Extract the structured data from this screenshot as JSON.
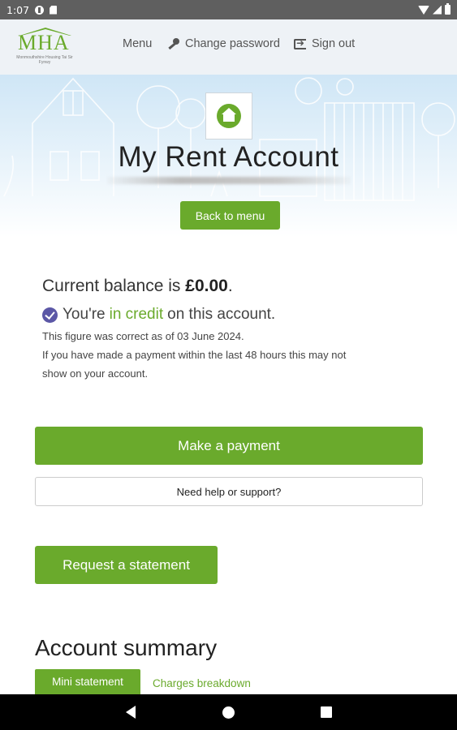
{
  "status_bar": {
    "time": "1:07"
  },
  "header": {
    "logo_text": "MHA",
    "logo_tagline": "Monmouthshire Housing Tai Sir Fynwy",
    "nav": [
      {
        "label": "Menu",
        "icon": "grid-icon"
      },
      {
        "label": "Change password",
        "icon": "key-icon"
      },
      {
        "label": "Sign out",
        "icon": "sign-out-icon"
      }
    ]
  },
  "hero": {
    "title": "My Rent Account",
    "back_button": "Back to menu",
    "icon": "house-icon"
  },
  "balance": {
    "prefix": "Current balance is ",
    "amount": "£0.00",
    "suffix": ".",
    "status_prefix": "You're",
    "status_highlight": "in credit",
    "status_suffix": "on this account.",
    "note_1": "This figure was correct as of 03 June 2024.",
    "note_2": "If you have made a payment within the last 48 hours this may not",
    "note_3": "show on your account."
  },
  "actions": {
    "pay": "Make a payment",
    "help": "Need help or support?",
    "statement": "Request a statement"
  },
  "summary": {
    "title": "Account summary",
    "tabs": [
      "Mini statement",
      "Charges breakdown"
    ]
  },
  "colors": {
    "brand_green": "#6aaa2c",
    "check_purple": "#5b57a6"
  }
}
